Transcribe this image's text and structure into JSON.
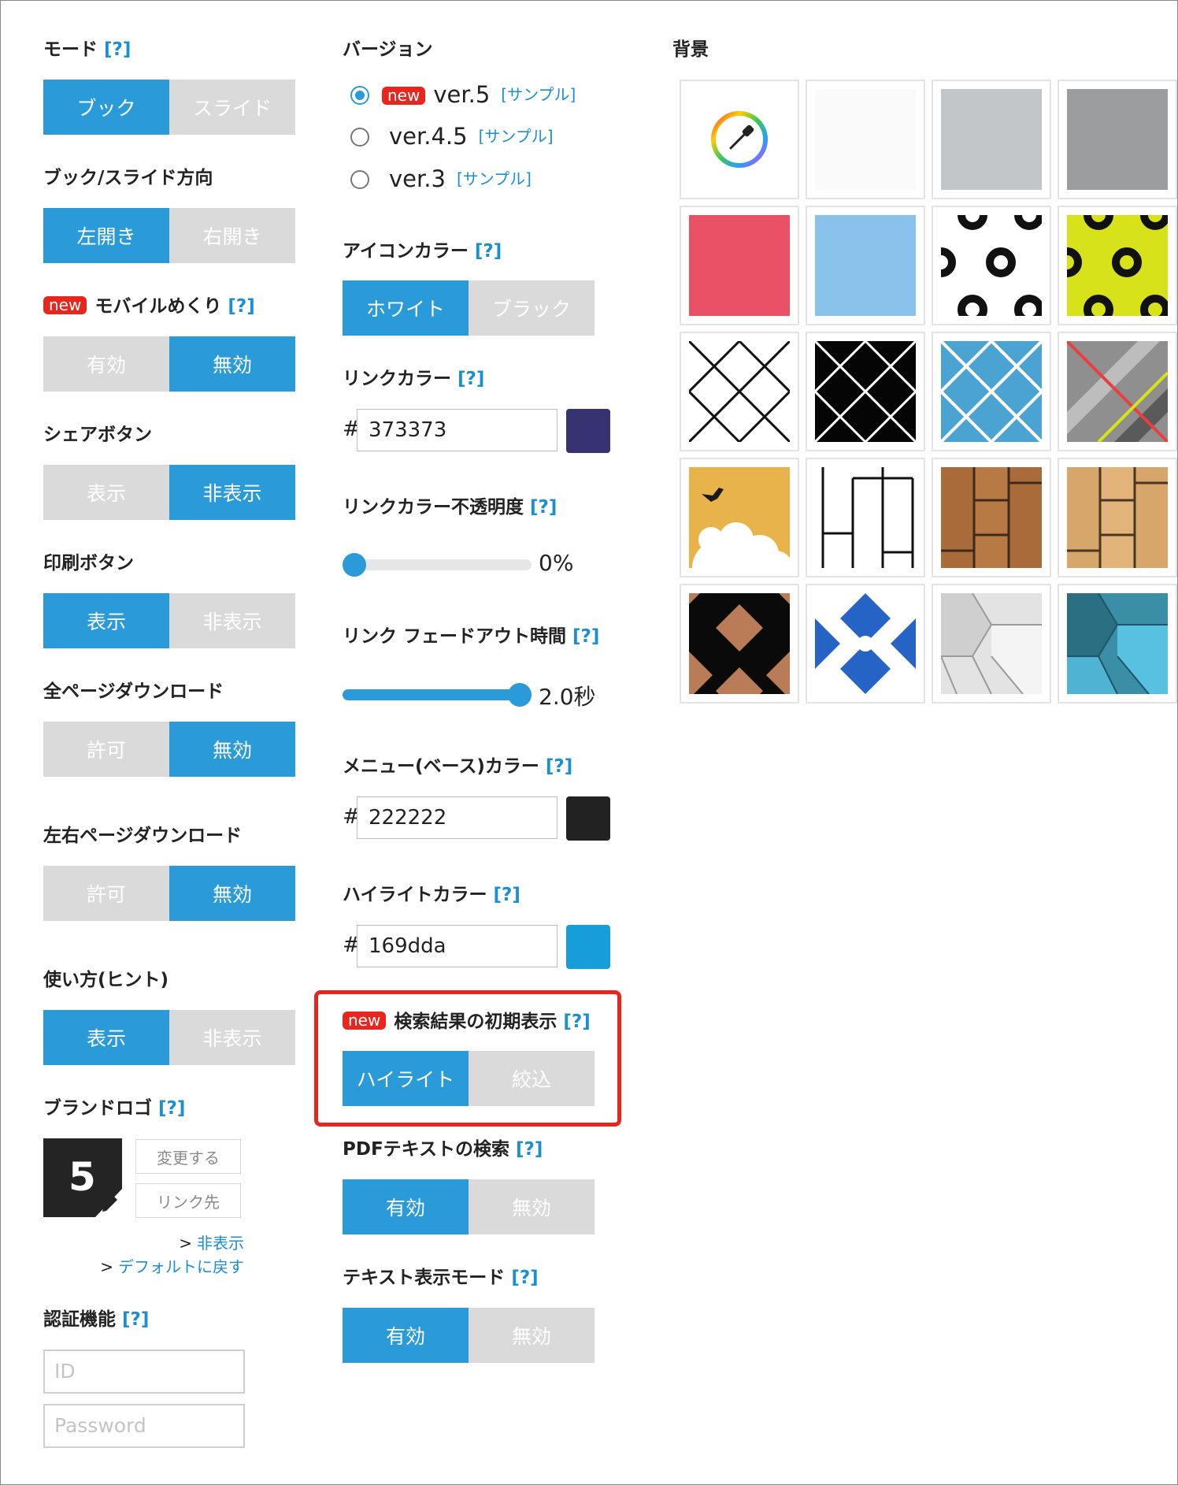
{
  "help": "[?]",
  "new_badge": "new",
  "left": {
    "mode": {
      "label": "モード",
      "options": [
        "ブック",
        "スライド"
      ],
      "active": 0
    },
    "direction": {
      "label": "ブック/スライド方向",
      "options": [
        "左開き",
        "右開き"
      ],
      "active": 0
    },
    "mobile_flip": {
      "label": "モバイルめくり",
      "options": [
        "有効",
        "無効"
      ],
      "active": 1
    },
    "share_button": {
      "label": "シェアボタン",
      "options": [
        "表示",
        "非表示"
      ],
      "active": 1
    },
    "print_button": {
      "label": "印刷ボタン",
      "options": [
        "表示",
        "非表示"
      ],
      "active": 0
    },
    "all_download": {
      "label": "全ページダウンロード",
      "options": [
        "許可",
        "無効"
      ],
      "active": 1
    },
    "lr_download": {
      "label": "左右ページダウンロード",
      "options": [
        "許可",
        "無効"
      ],
      "active": 1
    },
    "hint": {
      "label": "使い方(ヒント)",
      "options": [
        "表示",
        "非表示"
      ],
      "active": 0
    },
    "brand_logo": {
      "label": "ブランドロゴ",
      "logo_text": "5",
      "change_button": "変更する",
      "link_button": "リンク先",
      "hide_link": "非表示",
      "default_link": "デフォルトに戻す",
      "link_prefix": ">"
    },
    "auth": {
      "label": "認証機能",
      "id_placeholder": "ID",
      "password_placeholder": "Password"
    }
  },
  "middle": {
    "version": {
      "label": "バージョン",
      "options": [
        {
          "name": "ver.5",
          "sample": "[サンプル]",
          "is_new": true,
          "selected": true
        },
        {
          "name": "ver.4.5",
          "sample": "[サンプル]",
          "is_new": false,
          "selected": false
        },
        {
          "name": "ver.3",
          "sample": "[サンプル]",
          "is_new": false,
          "selected": false
        }
      ]
    },
    "icon_color": {
      "label": "アイコンカラー",
      "options": [
        "ホワイト",
        "ブラック"
      ],
      "active": 0
    },
    "link_color": {
      "label": "リンクカラー",
      "hash": "#",
      "value": "373373",
      "swatch": "#373373"
    },
    "link_opacity": {
      "label": "リンクカラー不透明度",
      "value_text": "0%",
      "fraction": 0.0
    },
    "fade_time": {
      "label": "リンク フェードアウト時間",
      "value_text": "2.0秒",
      "fraction": 1.0
    },
    "menu_color": {
      "label": "メニュー(ベース)カラー",
      "hash": "#",
      "value": "222222",
      "swatch": "#222222"
    },
    "highlight_color": {
      "label": "ハイライトカラー",
      "hash": "#",
      "value": "169dda",
      "swatch": "#169dda"
    },
    "search_initial": {
      "label": "検索結果の初期表示",
      "options": [
        "ハイライト",
        "絞込"
      ],
      "active": 0
    },
    "pdf_search": {
      "label": "PDFテキストの検索",
      "options": [
        "有効",
        "無効"
      ],
      "active": 0
    },
    "text_mode": {
      "label": "テキスト表示モード",
      "options": [
        "有効",
        "無効"
      ],
      "active": 0
    }
  },
  "right": {
    "background": {
      "label": "背景",
      "tiles": [
        "color-picker-icon",
        "white",
        "light-gray",
        "gray",
        "pink",
        "light-blue",
        "ring-pattern",
        "ring-pattern-lime",
        "lattice-white",
        "lattice-black",
        "lattice-blue",
        "diagonal-stripes",
        "bird-cloud",
        "brick-outline",
        "wood-dark",
        "wood-light",
        "diamond-brown",
        "quatrefoil-blue",
        "cube-gray",
        "cube-teal"
      ]
    }
  },
  "colors": {
    "accent": "#2a9ad8",
    "inactive": "#dadada",
    "help": "#1a8fd6",
    "new_badge": "#e8261d",
    "highlight_frame": "#e8261d"
  }
}
